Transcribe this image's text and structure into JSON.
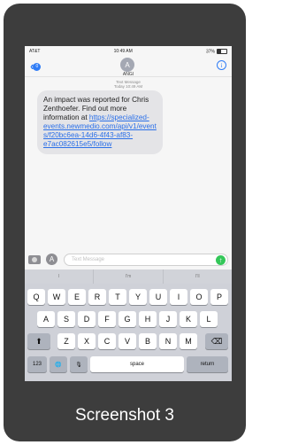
{
  "status_bar": {
    "carrier": "AT&T",
    "time": "10:49 AM",
    "battery": "37%"
  },
  "header": {
    "avatar_initial": "A",
    "contact": "ANGI",
    "back_badge": "0",
    "info": "i"
  },
  "thread": {
    "type": "Text Message",
    "timestamp": "Today 10:49 AM"
  },
  "message": {
    "text": "An impact was reported for Chris Zenthoefer. Find out more information at ",
    "link": "https://specialized-events.newmedio.com/api/v1/events/f20bc6ea-14d6-4f43-af83-e7ac082615e5/follow"
  },
  "input": {
    "placeholder": "Text Message",
    "send": "↑",
    "appstore": "A"
  },
  "predictions": [
    "I",
    "I'm",
    "I'll"
  ],
  "keyboard": {
    "row1": [
      "Q",
      "W",
      "E",
      "R",
      "T",
      "Y",
      "U",
      "I",
      "O",
      "P"
    ],
    "row2": [
      "A",
      "S",
      "D",
      "F",
      "G",
      "H",
      "J",
      "K",
      "L"
    ],
    "row3": [
      "Z",
      "X",
      "C",
      "V",
      "B",
      "N",
      "M"
    ],
    "shift": "⬆",
    "delete": "⌫",
    "numbers": "123",
    "globe": "🌐",
    "mic": "🎙",
    "space": "space",
    "return": "return"
  },
  "caption": "Screenshot 3",
  "colors": {
    "card": "#3d3d3d",
    "accent": "#2e7cf6",
    "send": "#34c759"
  }
}
